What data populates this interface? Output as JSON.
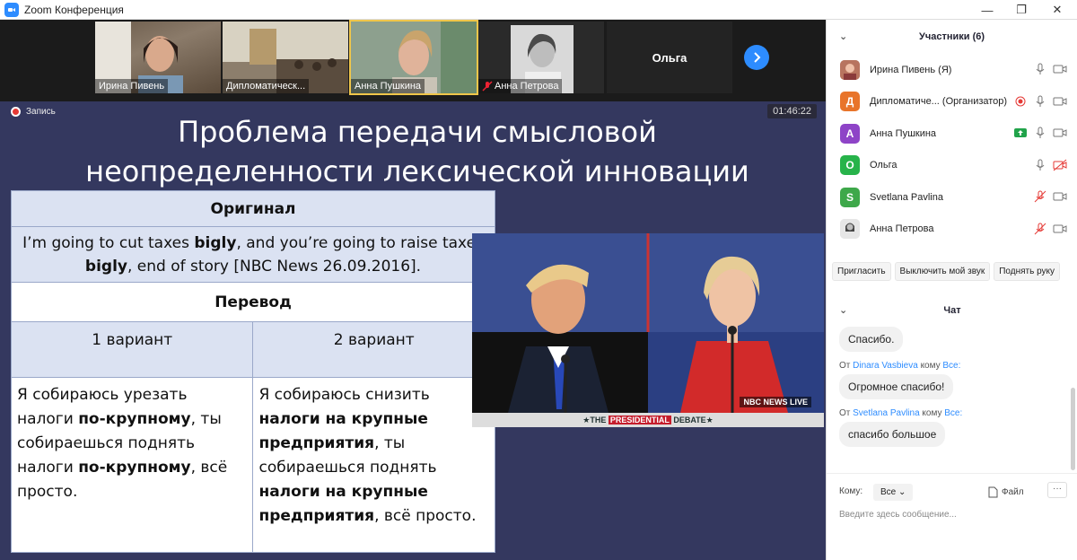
{
  "window": {
    "title": "Zoom Конференция"
  },
  "video_strip": [
    {
      "name": "Ирина Пивень"
    },
    {
      "name": "Дипломатическ..."
    },
    {
      "name": "Анна Пушкина"
    },
    {
      "name": "Анна Петрова"
    },
    {
      "name": "Ольга"
    }
  ],
  "recording": {
    "label": "Запись",
    "timer": "01:46:22"
  },
  "slide": {
    "title_line1": "Проблема передачи смысловой",
    "title_line2": "неопределенности лексической инновации",
    "table": {
      "original_header": "Оригинал",
      "quote_pre": "I’m going to cut taxes ",
      "quote_b1": "bigly",
      "quote_mid": ", and you’re going to raise taxes ",
      "quote_b2": "bigly",
      "quote_post": ", end of story [NBC News 26.09.2016].",
      "translation_header": "Перевод",
      "variant1_label": "1 вариант",
      "variant2_label": "2 вариант",
      "v1_a": "Я собираюсь урезать налоги ",
      "v1_b1": "по-крупному",
      "v1_c": ", ты собираешься поднять налоги ",
      "v1_b2": "по-крупному",
      "v1_d": ", всё просто.",
      "v2_a": "Я собираюсь снизить ",
      "v2_b1": "налоги на крупные предприятия",
      "v2_c": ", ты собираешься поднять ",
      "v2_b2": "налоги на крупные предприятия",
      "v2_d": ", всё просто."
    },
    "photo": {
      "ticker_pre": "★THE ",
      "ticker_red": "PRESIDENTIAL",
      "ticker_post": " DEBATE★",
      "network": "NBC NEWS LIVE"
    }
  },
  "participants": {
    "header": "Участники (6)",
    "list": [
      {
        "name": "Ирина Пивень (Я)",
        "initial": "",
        "color": "#c98a7a"
      },
      {
        "name": "Дипломатиче... (Организатор)",
        "initial": "Д",
        "color": "#e8742a"
      },
      {
        "name": "Анна Пушкина",
        "initial": "А",
        "color": "#8e44c7"
      },
      {
        "name": "Ольга",
        "initial": "О",
        "color": "#27b34a"
      },
      {
        "name": "Svetlana Pavlina",
        "initial": "S",
        "color": "#3ea84a"
      },
      {
        "name": "Анна Петрова",
        "initial": "",
        "color": "#999999"
      }
    ],
    "actions": {
      "invite": "Пригласить",
      "mute_me": "Выключить мой звук",
      "raise_hand": "Поднять руку"
    }
  },
  "chat": {
    "header": "Чат",
    "messages": [
      {
        "text": "Спасибо."
      },
      {
        "from_label": "От",
        "from": "Dinara Vasbieva",
        "to_label": "кому",
        "to": "Все:",
        "text": "Огромное спасибо!"
      },
      {
        "from_label": "От",
        "from": "Svetlana Pavlina",
        "to_label": "кому",
        "to": "Все:",
        "text": "спасибо большое"
      }
    ],
    "to_label": "Кому:",
    "to_value": "Все",
    "file_label": "Файл",
    "more_label": "···",
    "placeholder": "Введите здесь сообщение..."
  }
}
